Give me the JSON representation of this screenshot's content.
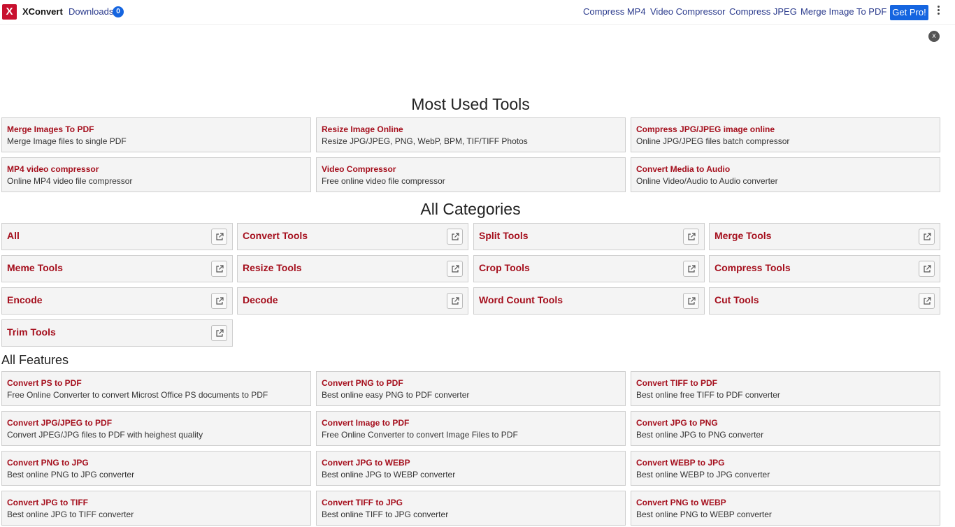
{
  "header": {
    "logo_letter": "X",
    "brand": "XConvert",
    "downloads_label": "Downloads",
    "downloads_count": "0",
    "nav": [
      "Compress MP4",
      "Video Compressor",
      "Compress JPEG",
      "Merge Image To PDF"
    ],
    "get_pro": "Get Pro!"
  },
  "ad_close": "x",
  "most_used": {
    "title": "Most Used Tools",
    "items": [
      {
        "title": "Merge Images To PDF",
        "desc": "Merge Image files to single PDF"
      },
      {
        "title": "Resize Image Online",
        "desc": "Resize JPG/JPEG, PNG, WebP, BPM, TIF/TIFF Photos"
      },
      {
        "title": "Compress JPG/JPEG image online",
        "desc": "Online JPG/JPEG files batch compressor"
      },
      {
        "title": "MP4 video compressor",
        "desc": "Online MP4 video file compressor"
      },
      {
        "title": "Video Compressor",
        "desc": "Free online video file compressor"
      },
      {
        "title": "Convert Media to Audio",
        "desc": "Online Video/Audio to Audio converter"
      }
    ]
  },
  "categories": {
    "title": "All Categories",
    "items": [
      "All",
      "Convert Tools",
      "Split Tools",
      "Merge Tools",
      "Meme Tools",
      "Resize Tools",
      "Crop Tools",
      "Compress Tools",
      "Encode",
      "Decode",
      "Word Count Tools",
      "Cut Tools",
      "Trim Tools"
    ]
  },
  "features": {
    "title": "All Features",
    "items": [
      {
        "title": "Convert PS to PDF",
        "desc": "Free Online Converter to convert Microst Office PS documents to PDF"
      },
      {
        "title": "Convert PNG to PDF",
        "desc": "Best online easy PNG to PDF converter"
      },
      {
        "title": "Convert TIFF to PDF",
        "desc": "Best online free TIFF to PDF converter"
      },
      {
        "title": "Convert JPG/JPEG to PDF",
        "desc": "Convert JPEG/JPG files to PDF with heighest quality"
      },
      {
        "title": "Convert Image to PDF",
        "desc": "Free Online Converter to convert Image Files to PDF"
      },
      {
        "title": "Convert JPG to PNG",
        "desc": "Best online JPG to PNG converter"
      },
      {
        "title": "Convert PNG to JPG",
        "desc": "Best online PNG to JPG converter"
      },
      {
        "title": "Convert JPG to WEBP",
        "desc": "Best online JPG to WEBP converter"
      },
      {
        "title": "Convert WEBP to JPG",
        "desc": "Best online WEBP to JPG converter"
      },
      {
        "title": "Convert JPG to TIFF",
        "desc": "Best online JPG to TIFF converter"
      },
      {
        "title": "Convert TIFF to JPG",
        "desc": "Best online TIFF to JPG converter"
      },
      {
        "title": "Convert PNG to WEBP",
        "desc": "Best online PNG to WEBP converter"
      }
    ]
  },
  "colors": {
    "accent": "#1565e0",
    "title_red": "#a50f1d",
    "logo_red": "#c8102e",
    "nav_blue": "#2a3a8c"
  }
}
